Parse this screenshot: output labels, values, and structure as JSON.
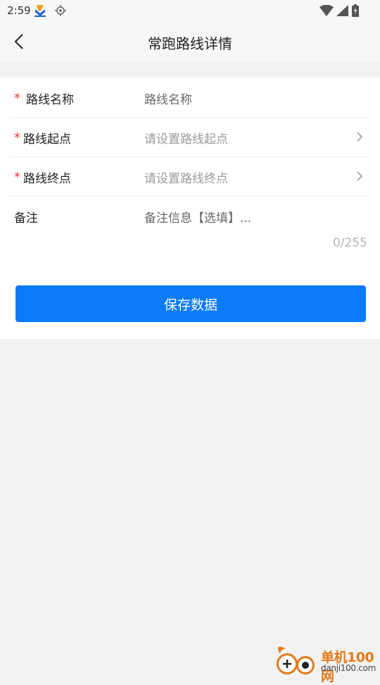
{
  "status_bar": {
    "time": "2:59"
  },
  "nav": {
    "title": "常跑路线详情"
  },
  "form": {
    "route_name": {
      "label": "路线名称",
      "value": "路线名称",
      "required": true
    },
    "start_point": {
      "label": "路线起点",
      "placeholder": "请设置路线起点",
      "required": true
    },
    "end_point": {
      "label": "路线终点",
      "placeholder": "请设置路线终点",
      "required": true
    },
    "notes": {
      "label": "备注",
      "placeholder": "备注信息【选填】...",
      "counter": "0/255"
    },
    "save_label": "保存数据"
  },
  "watermark": {
    "name": "单机100网",
    "url": "danji100.com"
  },
  "colors": {
    "primary": "#0b7bfa",
    "required": "#e9373a",
    "background": "#f2f2f2",
    "watermark_orange": "#e27a1a"
  }
}
